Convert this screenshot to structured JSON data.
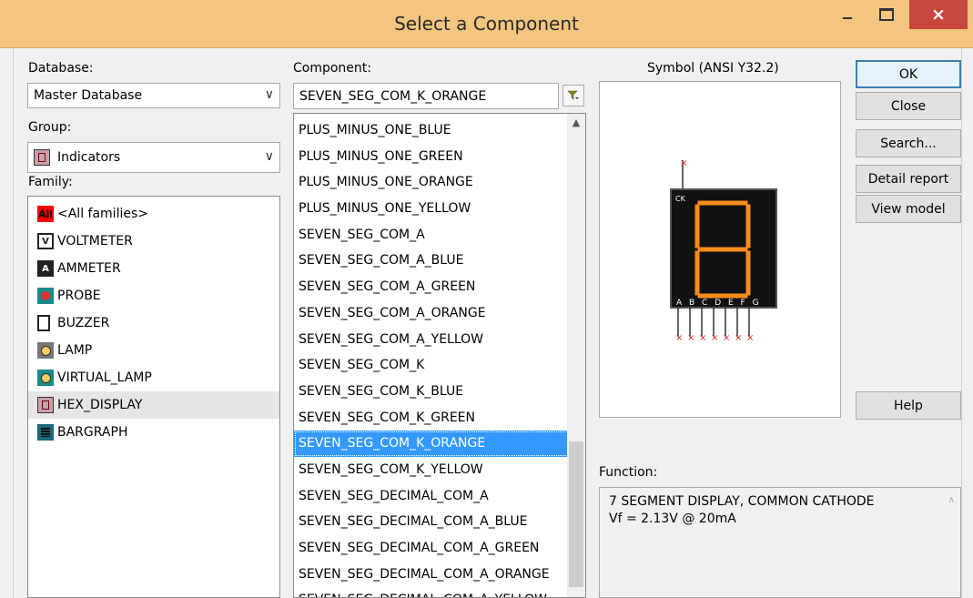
{
  "window": {
    "title": "Select a Component",
    "min_glyph": "–",
    "close_glyph": "×"
  },
  "database": {
    "label": "Database:",
    "value": "Master Database"
  },
  "group": {
    "label": "Group:",
    "value": "Indicators"
  },
  "family": {
    "label": "Family:",
    "items": [
      {
        "label": "<All families>",
        "icon": "all-families-icon",
        "icon_text": "All"
      },
      {
        "label": "VOLTMETER",
        "icon": "voltmeter-icon",
        "icon_text": "V"
      },
      {
        "label": "AMMETER",
        "icon": "ammeter-icon",
        "icon_text": "A"
      },
      {
        "label": "PROBE",
        "icon": "probe-icon",
        "icon_text": ""
      },
      {
        "label": "BUZZER",
        "icon": "buzzer-icon",
        "icon_text": ""
      },
      {
        "label": "LAMP",
        "icon": "lamp-icon",
        "icon_text": ""
      },
      {
        "label": "VIRTUAL_LAMP",
        "icon": "virtual-lamp-icon",
        "icon_text": ""
      },
      {
        "label": "HEX_DISPLAY",
        "icon": "hex-display-icon",
        "icon_text": ""
      },
      {
        "label": "BARGRAPH",
        "icon": "bargraph-icon",
        "icon_text": ""
      }
    ],
    "selected": "HEX_DISPLAY"
  },
  "component": {
    "label": "Component:",
    "value": "SEVEN_SEG_COM_K_ORANGE",
    "filter_icon": "filter-icon",
    "items": [
      "PLUS_MINUS_ONE_BLUE",
      "PLUS_MINUS_ONE_GREEN",
      "PLUS_MINUS_ONE_ORANGE",
      "PLUS_MINUS_ONE_YELLOW",
      "SEVEN_SEG_COM_A",
      "SEVEN_SEG_COM_A_BLUE",
      "SEVEN_SEG_COM_A_GREEN",
      "SEVEN_SEG_COM_A_ORANGE",
      "SEVEN_SEG_COM_A_YELLOW",
      "SEVEN_SEG_COM_K",
      "SEVEN_SEG_COM_K_BLUE",
      "SEVEN_SEG_COM_K_GREEN",
      "SEVEN_SEG_COM_K_ORANGE",
      "SEVEN_SEG_COM_K_YELLOW",
      "SEVEN_SEG_DECIMAL_COM_A",
      "SEVEN_SEG_DECIMAL_COM_A_BLUE",
      "SEVEN_SEG_DECIMAL_COM_A_GREEN",
      "SEVEN_SEG_DECIMAL_COM_A_ORANGE",
      "SEVEN_SEG_DECIMAL_COM_A_YELLOW"
    ],
    "selected_index": 12
  },
  "symbol": {
    "label": "Symbol (ANSI Y32.2)",
    "ck_label": "CK",
    "pin_labels": "A B C D E F G",
    "segment_color": "#ff8c1a"
  },
  "function": {
    "label": "Function:",
    "text": "7 SEGMENT DISPLAY, COMMON CATHODE\nVf = 2.13V @ 20mA"
  },
  "buttons": {
    "ok": "OK",
    "close": "Close",
    "search": "Search...",
    "detail_report": "Detail report",
    "view_model": "View model",
    "help": "Help"
  },
  "colors": {
    "titlebar": "#f4c57f",
    "close_button": "#c7473e",
    "selection": "#3399ff"
  }
}
